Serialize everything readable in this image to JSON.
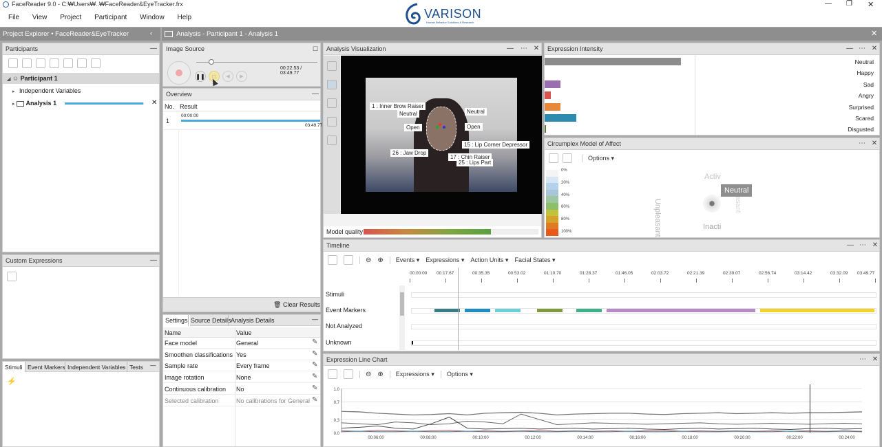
{
  "window": {
    "title": "FaceReader 9.0 - C:₩Users₩..₩FaceReader&EyeTracker.frx",
    "logo": "VARISON",
    "logo_sub": "Human Behavior Solutions & Research"
  },
  "menu": [
    "File",
    "View",
    "Project",
    "Participant",
    "Window",
    "Help"
  ],
  "project_explorer": {
    "title": "Project Explorer • FaceReader&EyeTracker",
    "participants_title": "Participants",
    "participant": "Participant 1",
    "independent_variables": "Independent Variables",
    "analysis": "Analysis 1",
    "analysis_progress": 0.99
  },
  "custom_expressions": {
    "title": "Custom Expressions"
  },
  "bottom_tabs": [
    "Stimuli",
    "Event Markers",
    "Independent Variables",
    "Tests"
  ],
  "analysis_tab": {
    "title": "Analysis - Participant 1 - Analysis 1"
  },
  "image_source": {
    "title": "Image Source",
    "time": "00:22.53 / 03:49.77",
    "slider_fraction": 0.1
  },
  "overview": {
    "title": "Overview",
    "col_no": "No.",
    "col_result": "Result",
    "row_no": "1",
    "start": "00:00:00",
    "end": "03:49.77",
    "clear": "Clear Results"
  },
  "settings": {
    "tabs": [
      "Settings",
      "Source Details",
      "Analysis Details"
    ],
    "col_name": "Name",
    "col_value": "Value",
    "rows": [
      {
        "name": "Face model",
        "value": "General"
      },
      {
        "name": "Smoothen classifications",
        "value": "Yes"
      },
      {
        "name": "Sample rate",
        "value": "Every frame"
      },
      {
        "name": "Image rotation",
        "value": "None"
      },
      {
        "name": "Continuous calibration",
        "value": "No"
      },
      {
        "name": "Selected calibration",
        "value": "No calibrations for General"
      }
    ]
  },
  "visualization": {
    "title": "Analysis Visualization",
    "labels": [
      "1 : Inner Brow Raiser",
      "Neutral",
      "Neutral",
      "Open",
      "Open",
      "26 : Jaw Drop",
      "15 : Lip Corner Depressor",
      "17 : Chin Raiser",
      "25 : Lips Part"
    ],
    "model_quality_label": "Model quality",
    "model_quality": 0.73
  },
  "expression_intensity": {
    "title": "Expression Intensity",
    "items": [
      {
        "name": "Neutral",
        "value": 0.87,
        "color": "#8c8c8c"
      },
      {
        "name": "Happy",
        "value": 0.0,
        "color": "#e0c020"
      },
      {
        "name": "Sad",
        "value": 0.1,
        "color": "#9a6fb0"
      },
      {
        "name": "Angry",
        "value": 0.04,
        "color": "#d9534f"
      },
      {
        "name": "Surprised",
        "value": 0.1,
        "color": "#e8863a"
      },
      {
        "name": "Scared",
        "value": 0.2,
        "color": "#2e8bb0"
      },
      {
        "name": "Disgusted",
        "value": 0.01,
        "color": "#5a7a3a"
      }
    ]
  },
  "circumplex": {
    "title": "Circumplex Model of Affect",
    "options": "Options",
    "scale": [
      "0%",
      "20%",
      "40%",
      "60%",
      "80%",
      "100%"
    ],
    "active": "Activ",
    "inactive": "Inacti",
    "unpleasant": "Unpleasant",
    "pleasant": "asant",
    "state": "Neutral"
  },
  "timeline": {
    "title": "Timeline",
    "menus": [
      "Events",
      "Expressions",
      "Action Units",
      "Facial States"
    ],
    "ticks": [
      "00:00:00",
      "00:17.67",
      "00:35.35",
      "00:53.02",
      "01:10.70",
      "01:28.37",
      "01:46.05",
      "02:03.72",
      "02:21.39",
      "02:39.07",
      "02:56.74",
      "03:14.42",
      "03:32.09",
      "03:49.77"
    ],
    "rows": [
      "Stimuli",
      "Event Markers",
      "Not Analyzed",
      "Unknown"
    ],
    "cursor_fraction": 0.1,
    "segments": [
      {
        "start": 0.05,
        "end": 0.105,
        "color": "#3a7d86"
      },
      {
        "start": 0.115,
        "end": 0.17,
        "color": "#1f8bbf"
      },
      {
        "start": 0.18,
        "end": 0.235,
        "color": "#6ed0d6"
      },
      {
        "start": 0.27,
        "end": 0.325,
        "color": "#7f9a3a"
      },
      {
        "start": 0.355,
        "end": 0.41,
        "color": "#3fb08a"
      },
      {
        "start": 0.42,
        "end": 0.74,
        "color": "#b58ac7"
      },
      {
        "start": 0.75,
        "end": 0.995,
        "color": "#f2d22a"
      }
    ]
  },
  "line_chart": {
    "title": "Expression Line Chart",
    "menus": [
      "Expressions",
      "Options"
    ],
    "cursor_fraction": 0.9
  }
}
